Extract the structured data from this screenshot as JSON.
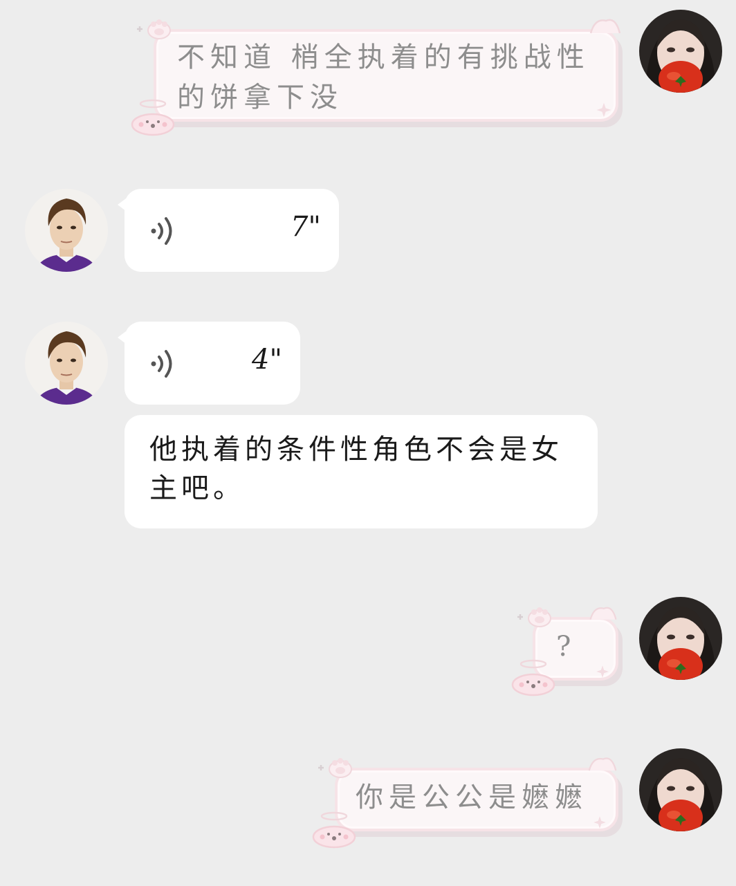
{
  "chat": {
    "messages": [
      {
        "sender": "me",
        "type": "text",
        "text_line1": "不知道 梢全执着的有挑战性",
        "text_line2": "的饼拿下没"
      },
      {
        "sender": "other",
        "type": "voice",
        "duration": "7\""
      },
      {
        "sender": "other",
        "type": "voice",
        "duration": "4\""
      },
      {
        "sender": "other",
        "type": "text",
        "text_line1": "他执着的条件性角色不会是女",
        "text_line2": "主吧。"
      },
      {
        "sender": "me",
        "type": "text",
        "text": "?"
      },
      {
        "sender": "me",
        "type": "text",
        "text": "你是公公是嬷嬷"
      }
    ]
  },
  "icons": {
    "voice": "voice-wave-icon",
    "bubble_deco": "paw-print-icon",
    "bunny_deco": "bunny-icon",
    "star_deco": "star-icon"
  },
  "colors": {
    "background": "#ededed",
    "incoming_bubble": "#ffffff",
    "outgoing_bubble": "#fbf6f7",
    "outgoing_border": "#f6e3e7",
    "outgoing_text": "#8d8d8d",
    "incoming_text": "#1a1a1a"
  }
}
